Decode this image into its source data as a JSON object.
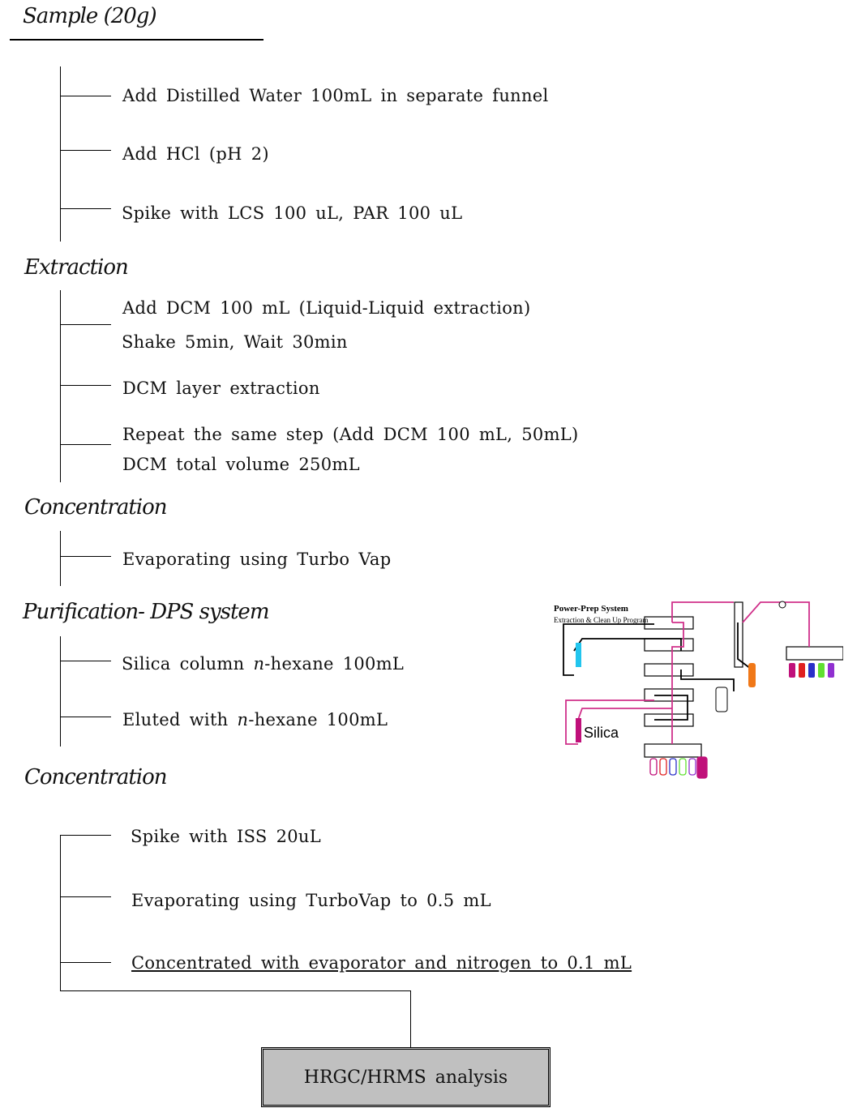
{
  "title": "Sample (20g)",
  "sections": [
    {
      "heading": "",
      "steps": [
        "Add Distilled Water 100mL in separate funnel",
        "Add HCl (pH 2)",
        "Spike with LCS 100 uL, PAR 100 uL"
      ]
    },
    {
      "heading": "Extraction",
      "steps": [
        "Add DCM 100 mL (Liquid-Liquid extraction)",
        "Shake 5min, Wait 30min",
        "DCM layer extraction",
        "Repeat the same step (Add DCM 100 mL, 50mL)",
        "DCM total volume 250mL"
      ]
    },
    {
      "heading": "Concentration",
      "steps": [
        "Evaporating using Turbo Vap"
      ]
    },
    {
      "heading": "Purification- DPS system",
      "steps": [
        "Silica column ",
        "n",
        "-hexane 100mL",
        "Eluted with ",
        "n",
        "-hexane 100mL"
      ]
    },
    {
      "heading": "Concentration",
      "steps": [
        "Spike with ISS 20uL",
        "Evaporating using TurboVap to 0.5 mL",
        "Concentrated with evaporator and nitrogen to 0.1 mL"
      ]
    }
  ],
  "final": "HRGC/HRMS analysis",
  "inset": {
    "title": "Power-Prep System",
    "subtitle": "Extraction & Clean Up Program",
    "column_label": "Silica",
    "colors": {
      "pink": "#d0308a",
      "cyan": "#22c5ee",
      "orange": "#f07818",
      "magenta": "#c0107a",
      "red": "#e02020",
      "blue": "#2a30c8",
      "green": "#60e030",
      "purple": "#9030d0"
    }
  }
}
